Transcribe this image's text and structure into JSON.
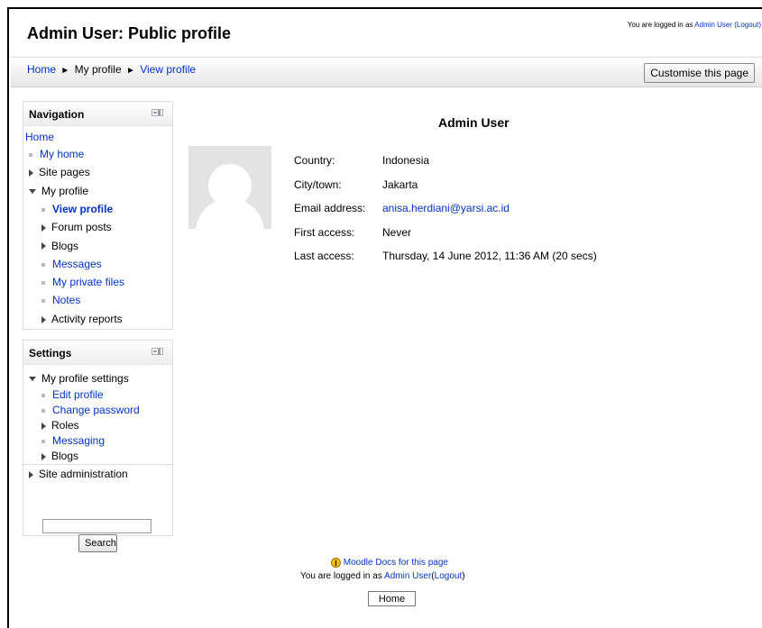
{
  "header": {
    "title": "Admin User: Public profile",
    "login_prefix": "You are logged in as ",
    "user": "Admin User",
    "logout": "(Logout)"
  },
  "navbar": {
    "breadcrumb": [
      "Home",
      "My profile",
      "View profile"
    ],
    "separator": "►",
    "customise_button": "Customise this page"
  },
  "navigation_block": {
    "title": "Navigation",
    "home": "Home",
    "items": [
      {
        "label": "My home",
        "type": "leaf",
        "link": true
      },
      {
        "label": "Site pages",
        "type": "collapsed",
        "link": false
      },
      {
        "label": "My profile",
        "type": "expanded",
        "link": false
      },
      {
        "label": "View profile",
        "type": "leaf",
        "link": true,
        "current": true
      },
      {
        "label": "Forum posts",
        "type": "collapsed",
        "link": false
      },
      {
        "label": "Blogs",
        "type": "collapsed",
        "link": false
      },
      {
        "label": "Messages",
        "type": "leaf",
        "link": true
      },
      {
        "label": "My private files",
        "type": "leaf",
        "link": true
      },
      {
        "label": "Notes",
        "type": "leaf",
        "link": true
      },
      {
        "label": "Activity reports",
        "type": "collapsed",
        "link": false
      }
    ]
  },
  "settings_block": {
    "title": "Settings",
    "items": [
      {
        "label": "My profile settings",
        "type": "expanded",
        "link": false
      },
      {
        "label": "Edit profile",
        "type": "leaf",
        "link": true
      },
      {
        "label": "Change password",
        "type": "leaf",
        "link": true
      },
      {
        "label": "Roles",
        "type": "collapsed",
        "link": false
      },
      {
        "label": "Messaging",
        "type": "leaf",
        "link": true
      },
      {
        "label": "Blogs",
        "type": "collapsed",
        "link": false
      },
      {
        "label": "Site administration",
        "type": "collapsed",
        "link": false
      }
    ],
    "search_value": "",
    "search_button": "Search"
  },
  "profile": {
    "name": "Admin User",
    "fields": [
      {
        "label": "Country:",
        "value": "Indonesia",
        "link": false
      },
      {
        "label": "City/town:",
        "value": "Jakarta",
        "link": false
      },
      {
        "label": "Email address:",
        "value": "anisa.herdiani@yarsi.ac.id",
        "link": true
      },
      {
        "label": "First access:",
        "value": "Never",
        "link": false
      },
      {
        "label": "Last access:",
        "value": "Thursday, 14 June 2012, 11:36 AM  (20 secs)",
        "link": false
      }
    ]
  },
  "footer": {
    "docs_link": "Moodle Docs for this page",
    "login_prefix": "You are logged in as ",
    "user": "Admin User",
    "logout_open": "(",
    "logout": "Logout",
    "logout_close": ")",
    "home_button": "Home"
  },
  "colors": {
    "link": "#0033cc",
    "help_icon": "#f5c000"
  },
  "icons": [
    "dock-icon",
    "help-icon",
    "avatar-placeholder",
    "arrow-right-icon",
    "arrow-down-icon",
    "bullet-icon"
  ]
}
